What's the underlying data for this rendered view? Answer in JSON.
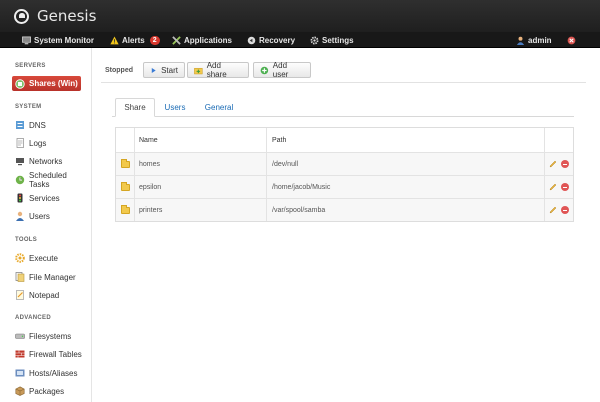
{
  "app": {
    "title": "Genesis"
  },
  "nav": {
    "items": [
      {
        "label": "System Monitor",
        "icon": "monitor-icon"
      },
      {
        "label": "Alerts",
        "icon": "warning-icon",
        "badge": "2"
      },
      {
        "label": "Applications",
        "icon": "tools-icon"
      },
      {
        "label": "Recovery",
        "icon": "recovery-icon"
      },
      {
        "label": "Settings",
        "icon": "gear-icon"
      }
    ],
    "user": "admin"
  },
  "sidebar": {
    "sections": [
      {
        "title": "SERVERS",
        "items": [
          {
            "label": "Shares (Win)",
            "icon": "shares-icon",
            "active": true
          }
        ]
      },
      {
        "title": "SYSTEM",
        "items": [
          {
            "label": "DNS",
            "icon": "dns-icon"
          },
          {
            "label": "Logs",
            "icon": "logs-icon"
          },
          {
            "label": "Networks",
            "icon": "network-icon"
          },
          {
            "label": "Scheduled Tasks",
            "icon": "tasks-icon"
          },
          {
            "label": "Services",
            "icon": "services-icon"
          },
          {
            "label": "Users",
            "icon": "users-icon"
          }
        ]
      },
      {
        "title": "TOOLS",
        "items": [
          {
            "label": "Execute",
            "icon": "execute-icon"
          },
          {
            "label": "File Manager",
            "icon": "file-manager-icon"
          },
          {
            "label": "Notepad",
            "icon": "notepad-icon"
          }
        ]
      },
      {
        "title": "ADVANCED",
        "items": [
          {
            "label": "Filesystems",
            "icon": "filesystems-icon"
          },
          {
            "label": "Firewall Tables",
            "icon": "firewall-icon"
          },
          {
            "label": "Hosts/Aliases",
            "icon": "hosts-icon"
          },
          {
            "label": "Packages",
            "icon": "packages-icon"
          }
        ]
      }
    ]
  },
  "toolbar": {
    "status": "Stopped",
    "start_label": "Start",
    "add_share_label": "Add share",
    "add_user_label": "Add user"
  },
  "tabs": [
    {
      "label": "Share",
      "active": true
    },
    {
      "label": "Users"
    },
    {
      "label": "General"
    }
  ],
  "table": {
    "columns": [
      "Name",
      "Path"
    ],
    "rows": [
      {
        "name": "homes",
        "path": "/dev/null"
      },
      {
        "name": "epsilon",
        "path": "/home/jacob/Music"
      },
      {
        "name": "printers",
        "path": "/var/spool/samba"
      }
    ]
  },
  "colors": {
    "active_red": "#c23b30",
    "link_blue": "#1a6bb5",
    "header_dark": "#262626"
  }
}
